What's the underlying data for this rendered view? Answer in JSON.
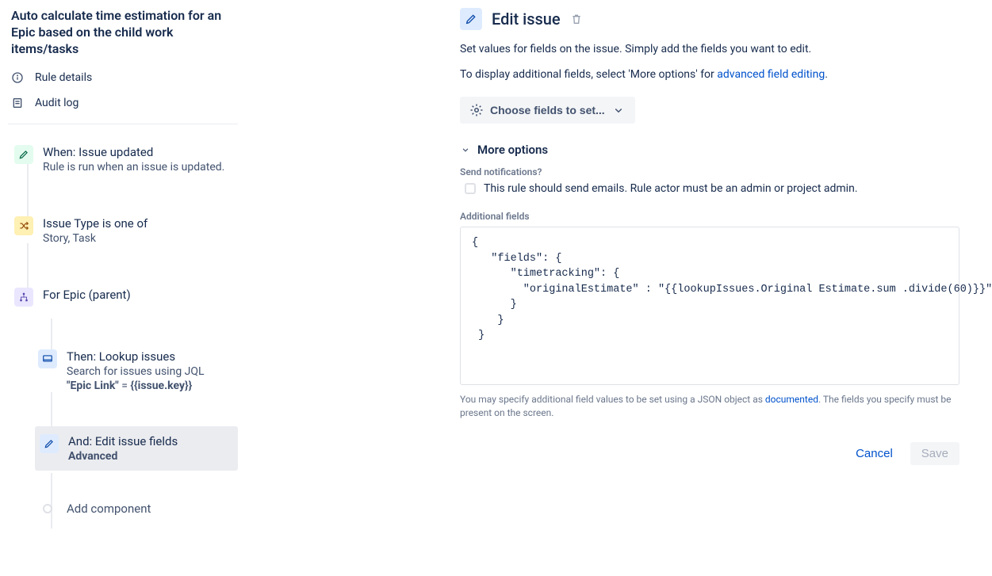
{
  "rule_title": "Auto calculate time estimation for an Epic based on the child work items/tasks",
  "utils": {
    "details": "Rule details",
    "audit": "Audit log"
  },
  "steps": {
    "trigger_title": "When: Issue updated",
    "trigger_desc": "Rule is run when an issue is updated.",
    "cond_title": "Issue Type is one of",
    "cond_desc": "Story, Task",
    "branch_title": "For Epic (parent)",
    "lookup_title": "Then: Lookup issues",
    "lookup_desc": "Search for issues using JQL",
    "lookup_jql_label": "\"Epic Link\"",
    "lookup_jql_eq": " = ",
    "lookup_jql_val": "{{issue.key}}",
    "edit_title": "And: Edit issue fields",
    "edit_desc": "Advanced",
    "add_component": "Add component"
  },
  "detail": {
    "title": "Edit issue",
    "desc": "Set values for fields on the issue. Simply add the fields you want to edit.",
    "hint_pre": "To display additional fields, select 'More options' for ",
    "hint_link": "advanced field editing",
    "choose_label": "Choose fields to set...",
    "more_label": "More options",
    "notify_label": "Send notifications?",
    "notify_check": "This rule should send emails. Rule actor must be an admin or project admin.",
    "additional_label": "Additional fields",
    "code": "{\n   \"fields\": {\n      \"timetracking\": {\n        \"originalEstimate\" : \"{{lookupIssues.Original Estimate.sum .divide(60)}}\"\n      }\n    }\n }",
    "help_pre": "You may specify additional field values to be set using a JSON object as ",
    "help_link": "documented",
    "help_post": ". The fields you specify must be present on the screen.",
    "cancel": "Cancel",
    "save": "Save"
  }
}
